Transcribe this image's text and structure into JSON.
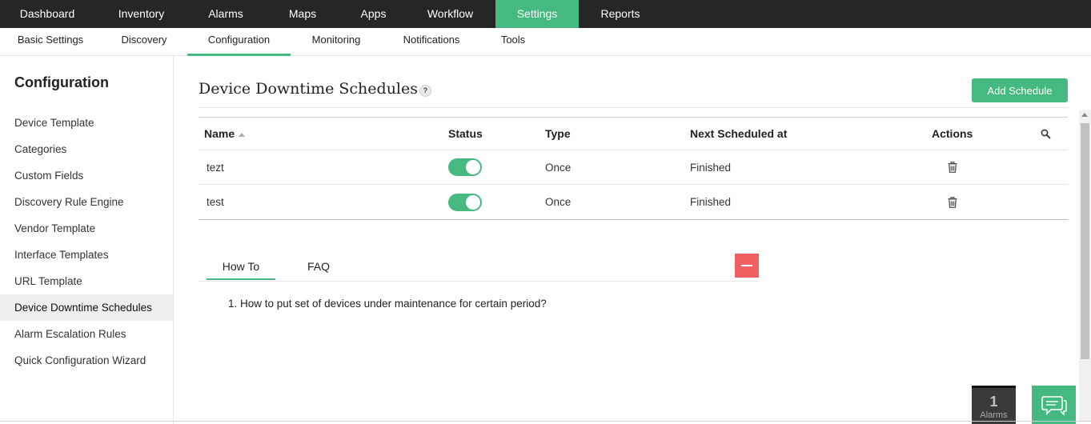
{
  "topnav": {
    "items": [
      {
        "label": "Dashboard"
      },
      {
        "label": "Inventory"
      },
      {
        "label": "Alarms"
      },
      {
        "label": "Maps"
      },
      {
        "label": "Apps"
      },
      {
        "label": "Workflow"
      },
      {
        "label": "Settings",
        "active": true
      },
      {
        "label": "Reports"
      }
    ]
  },
  "subnav": {
    "items": [
      {
        "label": "Basic Settings"
      },
      {
        "label": "Discovery"
      },
      {
        "label": "Configuration",
        "active": true
      },
      {
        "label": "Monitoring"
      },
      {
        "label": "Notifications"
      },
      {
        "label": "Tools"
      }
    ]
  },
  "sidebar": {
    "title": "Configuration",
    "items": [
      {
        "label": "Device Template"
      },
      {
        "label": "Categories"
      },
      {
        "label": "Custom Fields"
      },
      {
        "label": "Discovery Rule Engine"
      },
      {
        "label": "Vendor Template"
      },
      {
        "label": "Interface Templates"
      },
      {
        "label": "URL Template"
      },
      {
        "label": "Device Downtime Schedules",
        "active": true
      },
      {
        "label": "Alarm Escalation Rules"
      },
      {
        "label": "Quick Configuration Wizard"
      }
    ]
  },
  "main": {
    "title": "Device Downtime Schedules",
    "help_label": "?",
    "add_button_label": "Add Schedule",
    "table": {
      "columns": [
        "Name",
        "Status",
        "Type",
        "Next Scheduled at",
        "Actions"
      ],
      "rows": [
        {
          "name": "tezt",
          "status": "on",
          "type": "Once",
          "next": "Finished"
        },
        {
          "name": "test",
          "status": "on",
          "type": "Once",
          "next": "Finished"
        }
      ]
    },
    "help_tabs": [
      {
        "label": "How To",
        "active": true
      },
      {
        "label": "FAQ"
      }
    ],
    "howto_items": [
      "1. How to put set of devices under maintenance for certain period?"
    ]
  },
  "widgets": {
    "alarms_count": "1",
    "alarms_label": "Alarms"
  },
  "colors": {
    "accent": "#46b980",
    "topnav_bg": "#262626",
    "collapse": "#f06060"
  }
}
